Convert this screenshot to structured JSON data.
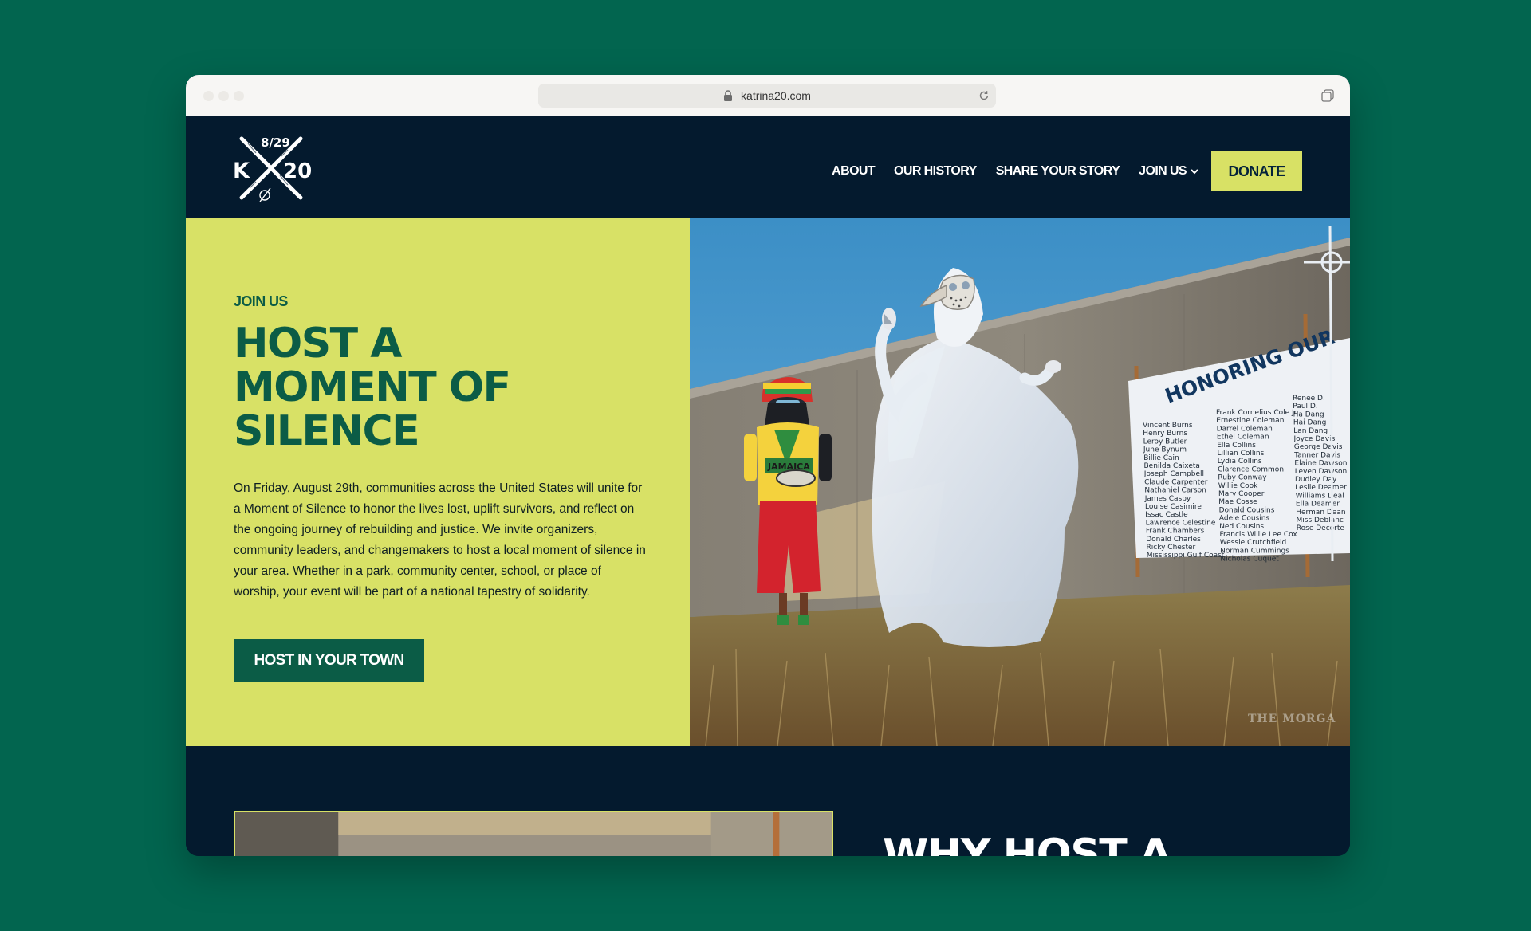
{
  "browser": {
    "url": "katrina20.com"
  },
  "header": {
    "logo": {
      "date": "8/29",
      "letter": "K",
      "number": "20"
    },
    "nav": [
      {
        "label": "ABOUT"
      },
      {
        "label": "OUR HISTORY"
      },
      {
        "label": "SHARE YOUR STORY"
      },
      {
        "label": "JOIN US",
        "has_dropdown": true
      }
    ],
    "donate_label": "DONATE"
  },
  "hero": {
    "eyebrow": "JOIN US",
    "headline_lines": [
      "HOST A",
      "MOMENT OF",
      "SILENCE"
    ],
    "body": "On Friday, August 29th, communities across the United States will unite for a Moment of Silence to honor the lives lost, uplift survivors, and reflect on the ongoing journey of rebuilding and justice. We invite organizers, community leaders, and changemakers to host a local moment of silence in your area. Whether in a park, community center, school, or place of worship, your event will be part of a national tapestry of solidarity.",
    "cta_label": "HOST IN YOUR TOWN",
    "photo": {
      "banner_title": "HONORING OUR",
      "shirt_text": "JAMAICA",
      "watermark": "THE MORGA",
      "names_col1": [
        "Vincent Burns",
        "Henry Burns",
        "Leroy Butler",
        "June Bynum",
        "Billie Cain",
        "Benilda Caixeta",
        "Joseph Campbell",
        "Claude Carpenter",
        "Nathaniel Carson",
        "James Casby",
        "Louise Casimire",
        "Issac Castle",
        "Lawrence Celestine",
        "Frank Chambers",
        "Donald Charles",
        "Ricky Chester",
        "Mississippi Gulf Coast"
      ],
      "names_col2": [
        "Frank Cornelius Cole Jr.",
        "Ernestine Coleman",
        "Darrel Coleman",
        "Ethel Coleman",
        "Ella Collins",
        "Lillian Collins",
        "Lydia Collins",
        "Clarence Common",
        "Ruby Conway",
        "Willie Cook",
        "Mary Cooper",
        "Mae Cosse",
        "Donald Cousins",
        "Adele Cousins",
        "Ned Cousins",
        "Francis Willie Lee Cox",
        "Wessie Crutchfield",
        "Norman Cummings",
        "Nicholas Cuquet"
      ],
      "names_col3": [
        "Renee D.",
        "Paul D.",
        "Ha Dang",
        "Hai Dang",
        "Lan Dang",
        "Joyce Davis",
        "George Davis",
        "Tanner Davis",
        "Elaine Dawson",
        "Leven Dawson",
        "Dudley Day",
        "Leslie Deamer",
        "Williams Deal",
        "Ella Deamer",
        "Herman Dean",
        "Miss Deblanc",
        "Rose Decorte"
      ]
    }
  },
  "section2": {
    "heading": "WHY HOST A"
  },
  "colors": {
    "background": "#02654f",
    "navy": "#041a2e",
    "lime": "#d8e165",
    "green": "#0b5c46"
  }
}
